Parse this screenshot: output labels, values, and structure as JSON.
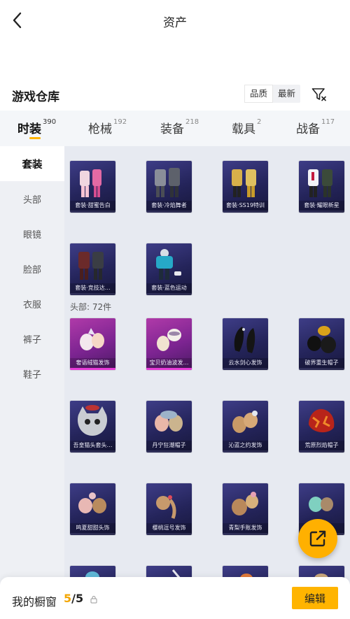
{
  "header": {
    "title": "资产"
  },
  "section": {
    "title": "游戏仓库",
    "sort_options": [
      "品质",
      "最新"
    ],
    "active_sort": 0
  },
  "tabs": [
    {
      "label": "时装",
      "count": "390"
    },
    {
      "label": "枪械",
      "count": "192"
    },
    {
      "label": "装备",
      "count": "218"
    },
    {
      "label": "载具",
      "count": "2"
    },
    {
      "label": "战备",
      "count": "117"
    }
  ],
  "sidebar": {
    "items": [
      "套装",
      "头部",
      "眼镜",
      "脸部",
      "衣服",
      "裤子",
      "鞋子"
    ]
  },
  "outfits": [
    {
      "label": "套装·甜蜜告白",
      "rarity": "purple"
    },
    {
      "label": "套装·冷焰舞者",
      "rarity": "purple"
    },
    {
      "label": "套装·SS19特训",
      "rarity": "purple"
    },
    {
      "label": "套装·耀眼新星",
      "rarity": "purple"
    },
    {
      "label": "套装·竞技达…",
      "rarity": "purple"
    },
    {
      "label": "套装·蓝色运动",
      "rarity": "purple"
    }
  ],
  "head_section": {
    "title": "头部: 72件"
  },
  "head_items": [
    {
      "label": "奢语绒猫发饰",
      "rarity": "pink"
    },
    {
      "label": "宝贝奶油波发…",
      "rarity": "pink"
    },
    {
      "label": "云水剑心发饰",
      "rarity": "purple"
    },
    {
      "label": "破界重生帽子",
      "rarity": "purple"
    },
    {
      "label": "吾皇猫头套头…",
      "rarity": "purple"
    },
    {
      "label": "丹宁狂潮帽子",
      "rarity": "purple"
    },
    {
      "label": "沁蓝之约发饰",
      "rarity": "purple"
    },
    {
      "label": "荒原烈焰帽子",
      "rarity": "purple"
    },
    {
      "label": "鸣夏甜甜头饰",
      "rarity": "purple"
    },
    {
      "label": "樱桃逗号发饰",
      "rarity": "purple"
    },
    {
      "label": "青梨手账发饰",
      "rarity": "purple"
    },
    {
      "label": "…饰",
      "rarity": "purple"
    }
  ],
  "bottom": {
    "label": "我的橱窗",
    "current": "5",
    "total": "/5",
    "edit_label": "编辑"
  }
}
